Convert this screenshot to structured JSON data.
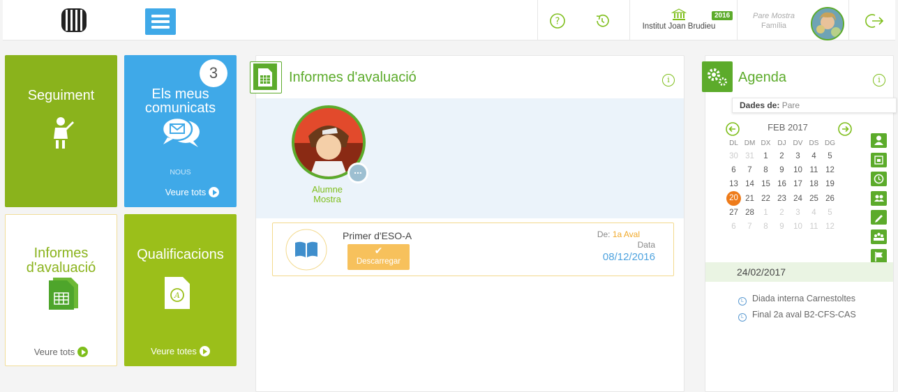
{
  "header": {
    "institution": "Institut Joan Brudieu",
    "year_badge": "2016",
    "user_name": "Pare Mostra",
    "user_role": "Família"
  },
  "tiles": {
    "seguiment": {
      "title": "Seguiment"
    },
    "comunicats": {
      "title": "Els meus comunicats",
      "badge": "3",
      "nous": "NOUS",
      "link": "Veure tots"
    },
    "informes": {
      "title": "Informes d'avaluació",
      "link": "Veure tots"
    },
    "qualificacions": {
      "title": "Qualificacions",
      "link": "Veure totes"
    }
  },
  "informes_panel": {
    "title": "Informes d'avaluació",
    "student_first": "Alumne",
    "student_last": "Mostra",
    "card": {
      "course": "Primer d'ESO-A",
      "download": "Descarregar",
      "de_label": "De:",
      "de_value": "1a Aval",
      "date_label": "Data",
      "date_value": "08/12/2016"
    }
  },
  "agenda": {
    "title": "Agenda",
    "dades_label": "Dades de:",
    "dades_value": "Pare",
    "month": "FEB 2017",
    "weekdays": [
      "DL",
      "DM",
      "DX",
      "DJ",
      "DV",
      "DS",
      "DG"
    ],
    "weeks": [
      [
        "30",
        "31",
        "1",
        "2",
        "3",
        "4",
        "5"
      ],
      [
        "6",
        "7",
        "8",
        "9",
        "10",
        "11",
        "12"
      ],
      [
        "13",
        "14",
        "15",
        "16",
        "17",
        "18",
        "19"
      ],
      [
        "20",
        "21",
        "22",
        "23",
        "24",
        "25",
        "26"
      ],
      [
        "27",
        "28",
        "1",
        "2",
        "3",
        "4",
        "5"
      ],
      [
        "6",
        "7",
        "8",
        "9",
        "10",
        "11",
        "12"
      ]
    ],
    "selected_date": "24/02/2017",
    "events": [
      "Diada interna Carnestoltes",
      "Final 2a aval B2-CFS-CAS"
    ]
  },
  "colors": {
    "green": "#5cab2b",
    "lime": "#9bbf1a",
    "blue": "#3fa9e8",
    "orange": "#ee7b1a",
    "download": "#f7c15c"
  }
}
